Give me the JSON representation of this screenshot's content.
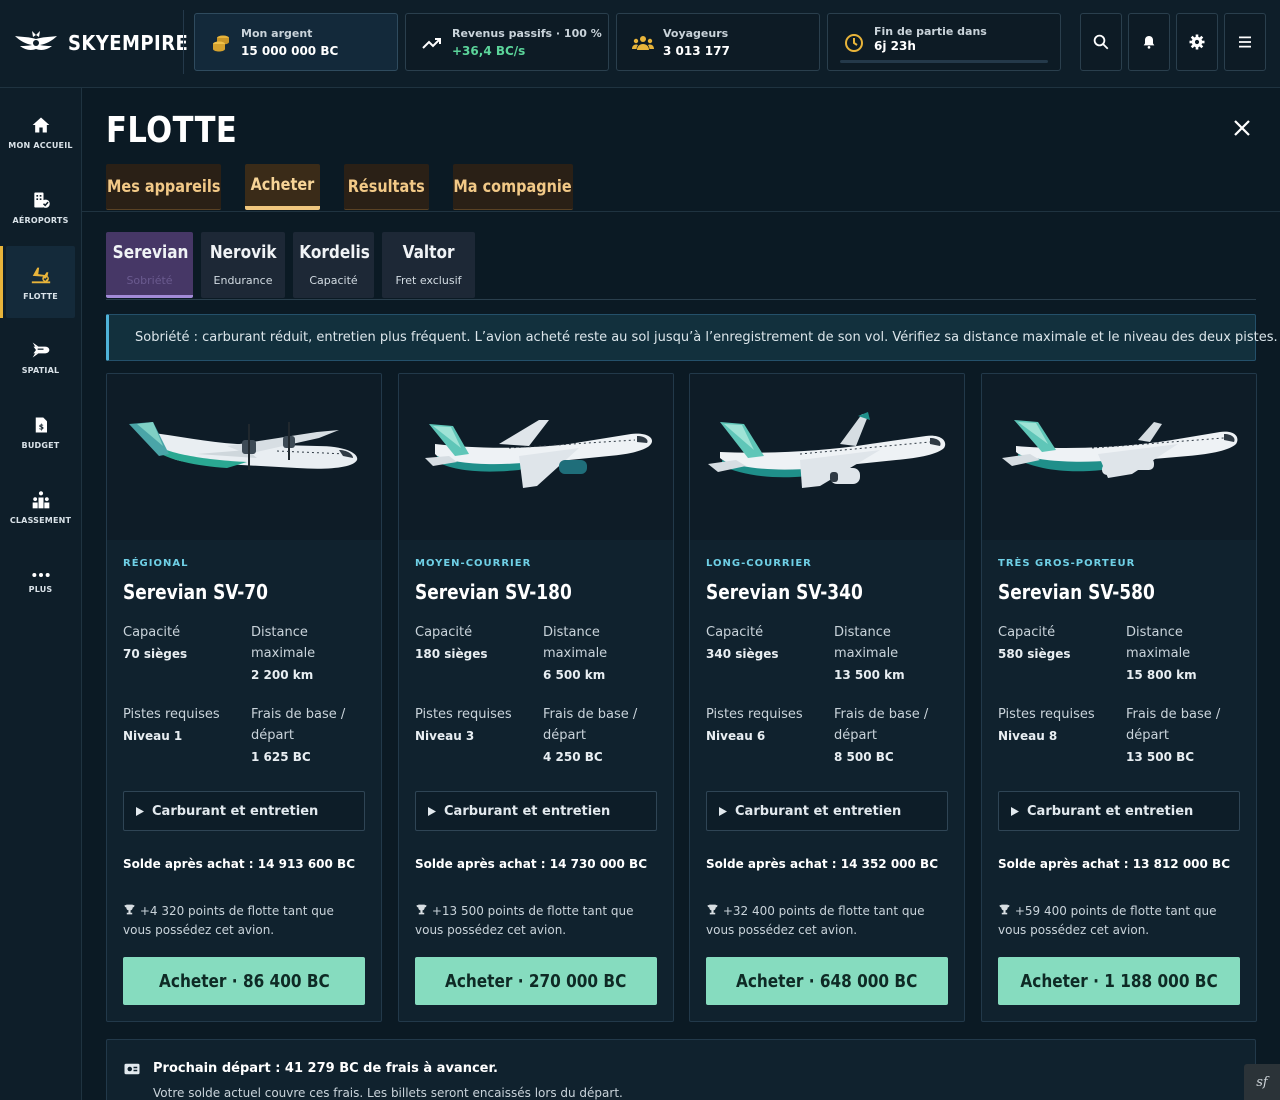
{
  "app": {
    "name": "SKYEMPIRE"
  },
  "stats": {
    "money": {
      "label": "Mon argent",
      "value": "15 000 000 BC"
    },
    "revenue": {
      "label": "Revenus passifs · 100 %",
      "value": "+36,4 BC/s"
    },
    "travelers": {
      "label": "Voyageurs",
      "value": "3 013 177"
    },
    "endgame": {
      "label": "Fin de partie dans",
      "value": "6j 23h"
    }
  },
  "colors": {
    "accent": "#86dcbf",
    "gold": "#e8b43a",
    "brand_active": "#463766",
    "info_border": "#4fb3d9"
  },
  "sidebar": {
    "items": [
      {
        "label": "MON ACCUEIL",
        "icon": "home-icon"
      },
      {
        "label": "AÉROPORTS",
        "icon": "airport-icon"
      },
      {
        "label": "FLOTTE",
        "icon": "plane-icon"
      },
      {
        "label": "SPATIAL",
        "icon": "rocket-icon"
      },
      {
        "label": "BUDGET",
        "icon": "budget-icon"
      },
      {
        "label": "CLASSEMENT",
        "icon": "ranking-icon"
      },
      {
        "label": "PLUS",
        "icon": "more-icon"
      }
    ]
  },
  "page": {
    "title": "FLOTTE"
  },
  "tabs": [
    {
      "label": "Mes appareils"
    },
    {
      "label": "Acheter"
    },
    {
      "label": "Résultats"
    },
    {
      "label": "Ma compagnie"
    }
  ],
  "brands": [
    {
      "name": "Serevian",
      "sub": "Sobriété"
    },
    {
      "name": "Nerovik",
      "sub": "Endurance"
    },
    {
      "name": "Kordelis",
      "sub": "Capacité"
    },
    {
      "name": "Valtor",
      "sub": "Fret exclusif"
    }
  ],
  "info": {
    "text": "Sobriété : carburant réduit, entretien plus fréquent. L’avion acheté reste au sol jusqu’à l’enregistrement de son vol. Vérifiez sa distance maximale et le niveau des deux pistes."
  },
  "spec_labels": {
    "capacity": "Capacité",
    "distance": "Distance maximale",
    "runways": "Pistes requises",
    "fees": "Frais de base / départ"
  },
  "fuel_label": "Carburant et entretien",
  "cards": [
    {
      "category": "RÉGIONAL",
      "name": "Serevian SV-70",
      "capacity": "70 sièges",
      "distance": "2 200 km",
      "runways": "Niveau 1",
      "fees": "1 625 BC",
      "balance": "Solde après achat : 14 913 600 BC",
      "points": "+4 320 points de flotte tant que vous possédez cet avion.",
      "buy": "Acheter · 86 400 BC"
    },
    {
      "category": "MOYEN-COURRIER",
      "name": "Serevian SV-180",
      "capacity": "180 sièges",
      "distance": "6 500 km",
      "runways": "Niveau 3",
      "fees": "4 250 BC",
      "balance": "Solde après achat : 14 730 000 BC",
      "points": "+13 500 points de flotte tant que vous possédez cet avion.",
      "buy": "Acheter · 270 000 BC"
    },
    {
      "category": "LONG-COURRIER",
      "name": "Serevian SV-340",
      "capacity": "340 sièges",
      "distance": "13 500 km",
      "runways": "Niveau 6",
      "fees": "8 500 BC",
      "balance": "Solde après achat : 14 352 000 BC",
      "points": "+32 400 points de flotte tant que vous possédez cet avion.",
      "buy": "Acheter · 648 000 BC"
    },
    {
      "category": "TRÈS GROS-PORTEUR",
      "name": "Serevian SV-580",
      "capacity": "580 sièges",
      "distance": "15 800 km",
      "runways": "Niveau 8",
      "fees": "13 500 BC",
      "balance": "Solde après achat : 13 812 000 BC",
      "points": "+59 400 points de flotte tant que vous possédez cet avion.",
      "buy": "Acheter · 1 188 000 BC"
    }
  ],
  "departure": {
    "title": "Prochain départ : 41 279 BC de frais à avancer.",
    "sub": "Votre solde actuel couvre ces frais. Les billets seront encaissés lors du départ."
  },
  "debug_badge": "sf"
}
